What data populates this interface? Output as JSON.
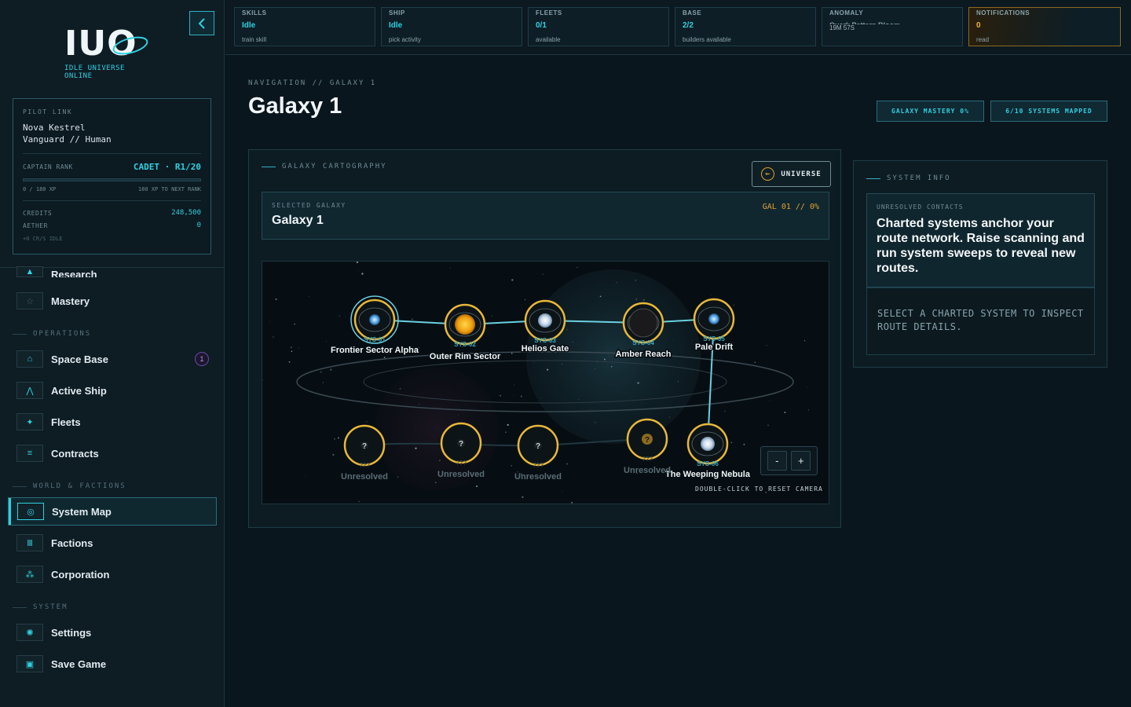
{
  "brand": {
    "logo": "IUO",
    "subtitle": "IDLE UNIVERSE ONLINE"
  },
  "pilot": {
    "heading": "PILOT LINK",
    "name": "Nova Kestrel",
    "role": "Vanguard // Human",
    "rank_label": "CAPTAIN RANK",
    "rank_value": "CADET · R1/20",
    "xp": "0 / 180 XP",
    "xp_next": "180 XP TO NEXT RANK",
    "xp_progress": 0,
    "credits_label": "CREDITS",
    "credits": "248,500",
    "aether_label": "AETHER",
    "aether": "0",
    "idle": "+0 CR/S IDLE"
  },
  "nav": {
    "research": "Research",
    "mastery": "Mastery",
    "operations": "OPERATIONS",
    "space_base": "Space Base",
    "space_base_badge": "1",
    "active_ship": "Active Ship",
    "fleets": "Fleets",
    "contracts": "Contracts",
    "world": "WORLD & FACTIONS",
    "system_map": "System Map",
    "factions": "Factions",
    "corporation": "Corporation",
    "system": "SYSTEM",
    "settings": "Settings",
    "save_game": "Save Game"
  },
  "topbar": [
    {
      "title": "SKILLS",
      "value": "Idle",
      "sub": "train skill"
    },
    {
      "title": "SHIP",
      "value": "Idle",
      "sub": "pick activity"
    },
    {
      "title": "FLEETS",
      "value": "0/1",
      "sub": "available"
    },
    {
      "title": "BASE",
      "value": "2/2",
      "sub": "builders available"
    },
    {
      "title": "ANOMALY",
      "value": "Quark Pattern Bloom",
      "sub": "19M 57S"
    },
    {
      "title": "NOTIFICATIONS",
      "value": "0",
      "sub": "read"
    }
  ],
  "page": {
    "breadcrumb": "NAVIGATION // GALAXY 1",
    "title": "Galaxy 1",
    "mastery_chip": "GALAXY MASTERY 0%",
    "mapped_chip": "6/10 SYSTEMS MAPPED"
  },
  "carto": {
    "heading": "GALAXY CARTOGRAPHY",
    "universe_btn": "UNIVERSE",
    "selected_label": "SELECTED GALAXY",
    "selected_name": "Galaxy 1",
    "selected_code": "GAL 01 // 0%",
    "reset_hint": "DOUBLE-CLICK TO RESET CAMERA",
    "zoom_out": "-",
    "zoom_in": "+"
  },
  "systems": [
    {
      "code": "SYS-01",
      "name": "Frontier Sector Alpha",
      "charted": true,
      "core": "blue",
      "selected": true
    },
    {
      "code": "SYS-02",
      "name": "Outer Rim Sector",
      "charted": true,
      "core": "sun"
    },
    {
      "code": "SYS-03",
      "name": "Helios Gate",
      "charted": true,
      "core": "white"
    },
    {
      "code": "SYS-04",
      "name": "Amber Reach",
      "charted": true,
      "core": "dark"
    },
    {
      "code": "SYS-05",
      "name": "Pale Drift",
      "charted": true,
      "core": "blue"
    },
    {
      "code": "SYS-06",
      "name": "The Weeping Nebula",
      "charted": true,
      "core": "white"
    },
    {
      "code": "???",
      "name": "Unresolved",
      "charted": false
    },
    {
      "code": "???",
      "name": "Unresolved",
      "charted": false
    },
    {
      "code": "???",
      "name": "Unresolved",
      "charted": false
    },
    {
      "code": "???",
      "name": "Unresolved",
      "charted": false
    }
  ],
  "info": {
    "heading": "SYSTEM INFO",
    "card_label": "UNRESOLVED CONTACTS",
    "card_text": "Charted systems anchor your route network. Raise scanning and run system sweeps to reveal new routes.",
    "hint": "SELECT A CHARTED SYSTEM TO INSPECT ROUTE DETAILS."
  },
  "colors": {
    "accent": "#2fd0e0",
    "gold": "#e8b83a",
    "bg": "#0a161d"
  }
}
